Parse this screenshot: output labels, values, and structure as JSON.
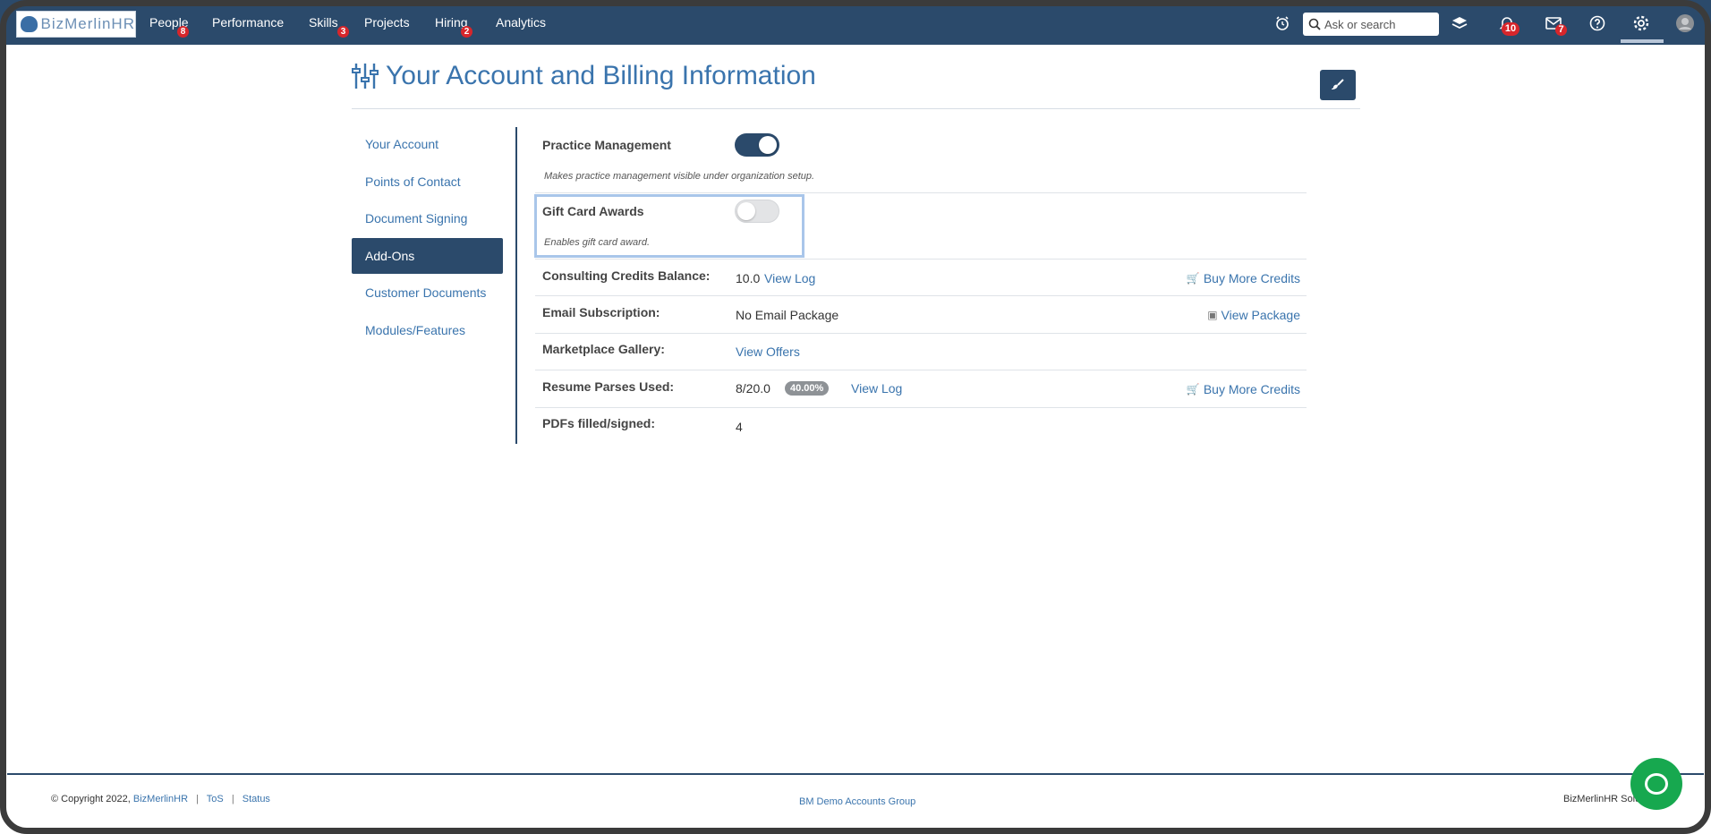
{
  "nav": {
    "logo_text": "BizMerlinHR",
    "items": [
      {
        "label": "People",
        "badge": "8"
      },
      {
        "label": "Performance",
        "badge": ""
      },
      {
        "label": "Skills",
        "badge": "3"
      },
      {
        "label": "Projects",
        "badge": ""
      },
      {
        "label": "Hiring",
        "badge": "2"
      },
      {
        "label": "Analytics",
        "badge": ""
      }
    ],
    "search_placeholder": "Ask or search",
    "notifications_badge": "10",
    "messages_badge": "7",
    "icons": [
      "alarm-clock-icon",
      "search-icon",
      "layers-icon",
      "bell-icon",
      "mail-icon",
      "help-icon",
      "gear-icon",
      "avatar-icon"
    ]
  },
  "page": {
    "title": "Your Account and Billing Information"
  },
  "sidebar": {
    "items": [
      {
        "label": "Your Account"
      },
      {
        "label": "Points of Contact"
      },
      {
        "label": "Document Signing"
      },
      {
        "label": "Add-Ons",
        "active": true
      },
      {
        "label": "Customer Documents"
      },
      {
        "label": "Modules/Features"
      }
    ]
  },
  "addons": {
    "practice_management": {
      "label": "Practice Management",
      "enabled": true,
      "description": "Makes practice management visible under organization setup."
    },
    "gift_card_awards": {
      "label": "Gift Card Awards",
      "enabled": false,
      "description": "Enables gift card award."
    },
    "consulting_credits": {
      "label": "Consulting Credits Balance:",
      "value": "10.0",
      "link": "View Log",
      "action": "Buy More Credits"
    },
    "email_subscription": {
      "label": "Email Subscription:",
      "value": "No Email Package",
      "action": "View Package"
    },
    "marketplace_gallery": {
      "label": "Marketplace Gallery:",
      "link": "View Offers"
    },
    "resume_parses": {
      "label": "Resume Parses Used:",
      "value": "8/20.0",
      "percent": "40.00%",
      "link": "View Log",
      "action": "Buy More Credits"
    },
    "pdfs_filled": {
      "label": "PDFs filled/signed:",
      "value": "4"
    }
  },
  "footer": {
    "copyright": "© Copyright 2022,",
    "company_link": "BizMerlinHR",
    "tos": "ToS",
    "status": "Status",
    "group": "BM Demo Accounts Group",
    "right_text": "BizMerlinHR Solu"
  },
  "colors": {
    "nav_bg": "#2b4a6b",
    "accent": "#3a74ad",
    "badge": "#d7262b",
    "chat": "#17a84f"
  }
}
